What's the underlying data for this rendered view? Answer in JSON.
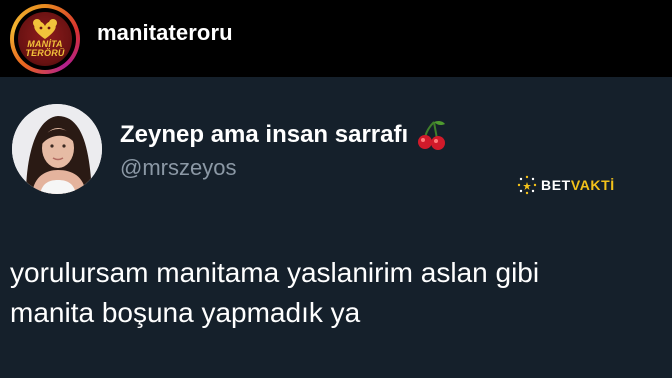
{
  "account": {
    "username": "manitateroru",
    "logo_text_line1": "MANİTA",
    "logo_text_line2": "TERÖRÜ",
    "logo_icon": "heart-bear-logo-icon"
  },
  "tweet": {
    "display_name": "Zeynep ama insan sarrafı",
    "name_emoji_icon": "cherry-icon",
    "handle": "@mrszeyos",
    "text_lines": [
      "yorulursam manitama yaslanirim aslan gibi",
      "manita boşuna yapmadık ya"
    ]
  },
  "watermark": {
    "part1": "BET",
    "part2": "VAKTİ",
    "icon": "sparkle-icon",
    "colors": {
      "part1": "#ffffff",
      "part2": "#f4c21a"
    }
  },
  "colors": {
    "background": "#15202b",
    "topbar": "#000000",
    "handle": "#8b98a5"
  }
}
